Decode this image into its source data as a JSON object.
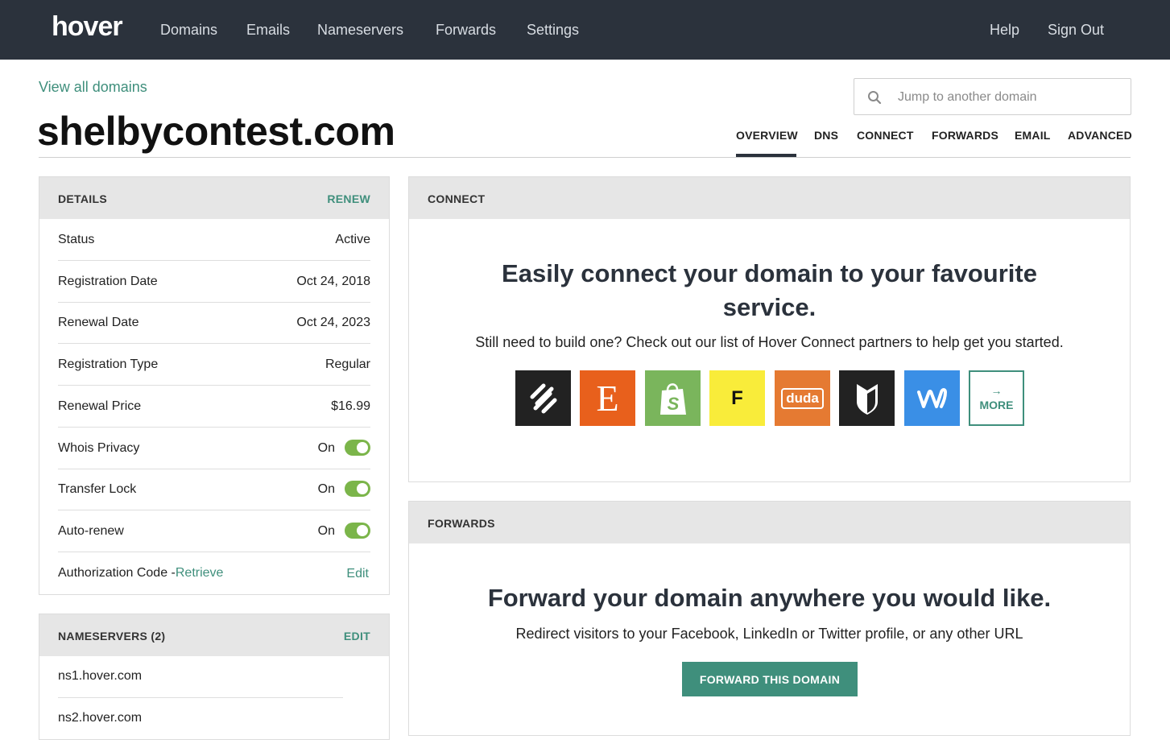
{
  "topbar": {
    "logo": "hover",
    "nav": [
      "Domains",
      "Emails",
      "Nameservers",
      "Forwards",
      "Settings"
    ],
    "right": [
      "Help",
      "Sign Out"
    ]
  },
  "header": {
    "view_all": "View all domains",
    "domain": "shelbycontest.com",
    "search_placeholder": "Jump to another domain",
    "tabs": [
      "OVERVIEW",
      "DNS",
      "CONNECT",
      "FORWARDS",
      "EMAIL",
      "ADVANCED"
    ],
    "active_tab": "OVERVIEW"
  },
  "details": {
    "title": "DETAILS",
    "action": "RENEW",
    "rows": [
      {
        "label": "Status",
        "value": "Active"
      },
      {
        "label": "Registration Date",
        "value": "Oct 24, 2018"
      },
      {
        "label": "Renewal Date",
        "value": "Oct 24, 2023"
      },
      {
        "label": "Registration Type",
        "value": "Regular"
      },
      {
        "label": "Renewal Price",
        "value": "$16.99"
      },
      {
        "label": "Whois Privacy",
        "value": "On",
        "toggle": true
      },
      {
        "label": "Transfer Lock",
        "value": "On",
        "toggle": true
      },
      {
        "label": "Auto-renew",
        "value": "On",
        "toggle": true
      }
    ],
    "auth_label": "Authorization Code -",
    "auth_link": "Retrieve",
    "auth_edit": "Edit"
  },
  "nameservers": {
    "title": "NAMESERVERS (2)",
    "action": "EDIT",
    "items": [
      "ns1.hover.com",
      "ns2.hover.com"
    ]
  },
  "connect": {
    "title": "CONNECT",
    "heading_line1": "Easily connect your domain to your favourite",
    "heading_line2": "service.",
    "subtext": "Still need to build one? Check out our list of Hover Connect partners to help get you started.",
    "partners": [
      {
        "name": "squarespace",
        "color": "#222222",
        "icon": "squarespace-icon"
      },
      {
        "name": "etsy",
        "color": "#e8601c",
        "icon": "etsy-icon",
        "glyph": "E"
      },
      {
        "name": "shopify",
        "color": "#7ab55c",
        "icon": "shopify-icon",
        "glyph": "S"
      },
      {
        "name": "format",
        "color": "#f9ec3a",
        "icon": "format-icon",
        "glyph": "F"
      },
      {
        "name": "duda",
        "color": "#e57a32",
        "icon": "duda-icon",
        "glyph": "duda"
      },
      {
        "name": "bigcartel",
        "color": "#222222",
        "icon": "bigcartel-icon"
      },
      {
        "name": "weebly",
        "color": "#3a8fe6",
        "icon": "weebly-icon"
      }
    ],
    "more_label": "MORE"
  },
  "forwards": {
    "title": "FORWARDS",
    "heading": "Forward your domain anywhere you would like.",
    "subtext": "Redirect visitors to your Facebook, LinkedIn or Twitter profile, or any other URL",
    "button": "FORWARD THIS DOMAIN"
  }
}
